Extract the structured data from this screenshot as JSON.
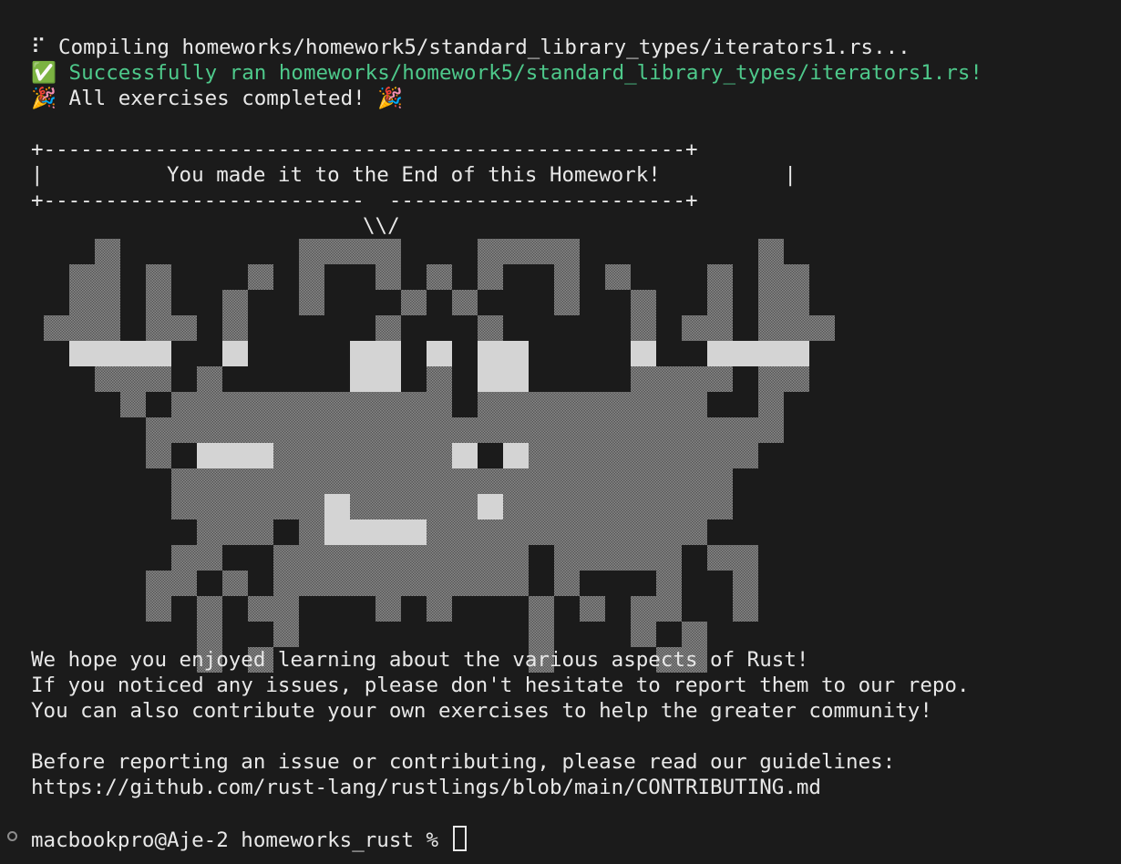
{
  "terminal": {
    "lines": {
      "compiling": "⠏ Compiling homeworks/homework5/standard_library_types/iterators1.rs...",
      "success": "✅ Successfully ran homeworks/homework5/standard_library_types/iterators1.rs!",
      "completed": "🎉 All exercises completed! 🎉"
    },
    "banner": {
      "top": "+----------------------------------------------------+",
      "middle": "|          You made it to the End of this Homework!          |",
      "bottom": "+--------------------------  ------------------------+",
      "tail": "\\\\/"
    },
    "message": {
      "line1": "We hope you enjoyed learning about the various aspects of Rust!",
      "line2": "If you noticed any issues, please don't hesitate to report them to our repo.",
      "line3": "You can also contribute your own exercises to help the greater community!",
      "line4": "Before reporting an issue or contributing, please read our guidelines:",
      "line5": "https://github.com/rust-lang/rustlings/blob/main/CONTRIBUTING.md"
    },
    "prompt": "macbookpro@Aje-2 homeworks_rust % "
  },
  "colors": {
    "background": "#1b1b1b",
    "text": "#e8e8e8",
    "success": "#4ec98b",
    "crab_dark": "#707070",
    "crab_light": "#d4d4d4"
  }
}
